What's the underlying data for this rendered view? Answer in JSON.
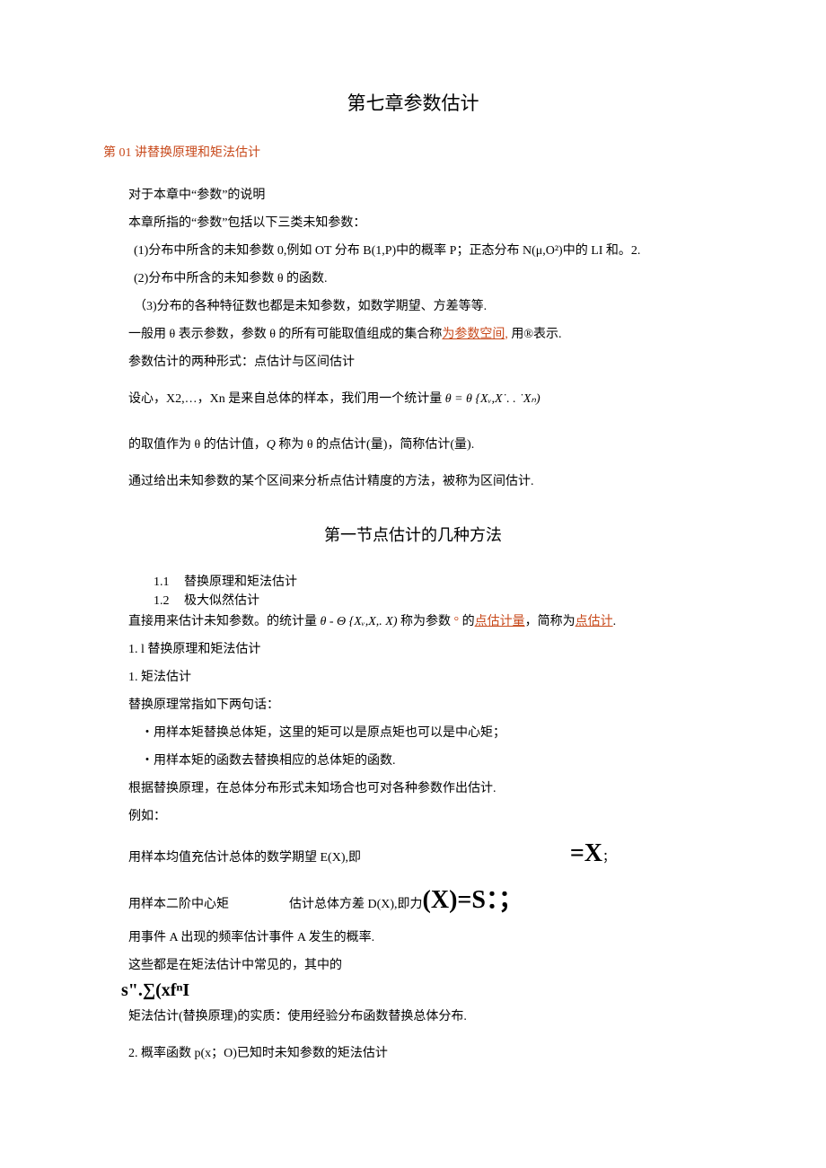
{
  "title": "第七章参数估计",
  "lecture": "第 01 讲替换原理和矩法估计",
  "intro1": "对于本章中“参数”的说明",
  "intro2": "本章所指的“参数”包括以下三类未知参数：",
  "item1": "(1)分布中所含的未知参数 0,例如 OT 分布 B(1,P)中的概率 P；正态分布 N(μ,O²)中的 LI 和。2.",
  "item2": "(2)分布中所含的未知参数 θ 的函数.",
  "item3": "（3)分布的各种特征数也都是未知参数，如数学期望、方差等等.",
  "line4_a": "一般用 θ 表示参数，参数 θ 的所有可能取值组成的集合称",
  "line4_b": "为参数空间,",
  "line4_c": " 用®表示.",
  "line5": "参数估计的两种形式：点估计与区间估计",
  "line6_a": "设心，X2,…，Xn 是来自总体的样本，我们用一个统计量  ",
  "line6_b": "θ = θ {Xᵥ,X˙. . ˙Xₙ)",
  "line7_a": "的取值作为 θ 的估计值，",
  "line7_b": "Q ",
  "line7_c": "称为 θ 的点估计(量)，简称估计(量).",
  "line8": "通过给出未知参数的某个区间来分析点估计精度的方法，被称为区间估计.",
  "section_title": "第一节点估计的几种方法",
  "n11_num": "1.1",
  "n11_txt": "替换原理和矩法估计",
  "n12_num": "1.2",
  "n12_txt": "极大似然估计",
  "line9_a": "直接用来估计未知参数。的统计量  ",
  "line9_b": "θ - Θ {Xᵥ,X,. X) ",
  "line9_c": "称为参数 ",
  "line9_d": "° ",
  "line9_e": "的",
  "line9_f": "点估计量",
  "line9_g": "，简称为",
  "line9_h": "点估计",
  "line9_i": ".",
  "h_1_1": "1. l 替换原理和矩法估计",
  "h_1": "1. 矩法估计",
  "line10": "替换原理常指如下两句话：",
  "bullet1": "・用样本矩替换总体矩，这里的矩可以是原点矩也可以是中心矩；",
  "bullet2": "・用样本矩的函数去替换相应的总体矩的函数.",
  "line11": "根据替换原理，在总体分布形式未知场合也可对各种参数作出估计.",
  "line12": "例如：",
  "line13_a": "用样本均值充估计总体的数学期望 E(X),即",
  "line13_b": "=X",
  "line13_c": "；",
  "line14_a": "用样本二阶中心矩",
  "line14_b": "估计总体方差 D(X),即力",
  "line14_c": "(X)=S：；",
  "line15": "用事件 A 出现的频率估计事件 A 发生的概率.",
  "line16": "这些都是在矩法估计中常见的，其中的",
  "formula": "s\".∑(xfⁿI",
  "line17": "矩法估计(替换原理)的实质：使用经验分布函数替换总体分布.",
  "line18": "2. 概率函数 p(x；O)已知时未知参数的矩法估计"
}
